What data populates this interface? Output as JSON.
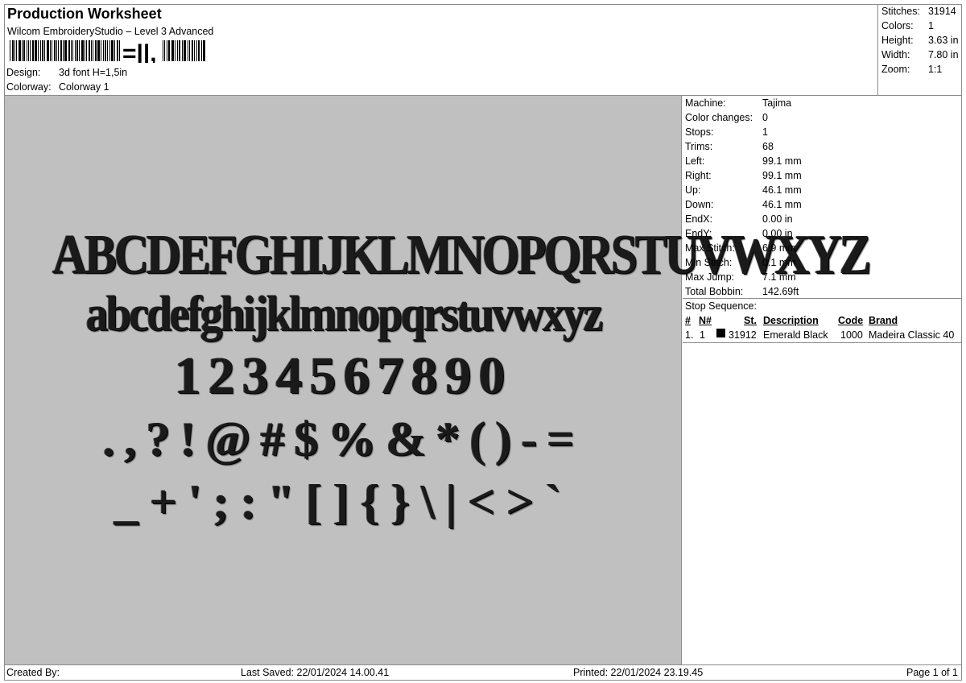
{
  "header": {
    "title": "Production Worksheet",
    "subtitle": "Wilcom EmbroideryStudio – Level 3 Advanced",
    "barcode_suffix": "=||,",
    "design_label": "Design:",
    "design_value": "3d font H=1,5in",
    "colorway_label": "Colorway:",
    "colorway_value": "Colorway 1"
  },
  "stats": [
    {
      "label": "Stitches:",
      "value": "31914"
    },
    {
      "label": "Colors:",
      "value": "1"
    },
    {
      "label": "Height:",
      "value": "3.63 in"
    },
    {
      "label": "Width:",
      "value": "7.80 in"
    },
    {
      "label": "Zoom:",
      "value": "1:1"
    }
  ],
  "design": {
    "rows": [
      "ABCDEFGHIJKLMNOPQRSTUVWXYZ",
      "abcdefghijklmnopqrstuvwxyz",
      "1234567890",
      ".,?!@#$%&*()-=",
      "_+';:\"[]{}\\|<>`"
    ],
    "thread_color": "#1a1a1a",
    "background_color": "#c0c0c0"
  },
  "machine": [
    {
      "label": "Machine:",
      "value": "Tajima"
    },
    {
      "label": "Color changes:",
      "value": "0"
    },
    {
      "label": "Stops:",
      "value": "1"
    },
    {
      "label": "Trims:",
      "value": "68"
    },
    {
      "label": "Left:",
      "value": "99.1 mm"
    },
    {
      "label": "Right:",
      "value": "99.1 mm"
    },
    {
      "label": "Up:",
      "value": "46.1 mm"
    },
    {
      "label": "Down:",
      "value": "46.1 mm"
    },
    {
      "label": "EndX:",
      "value": "0.00 in"
    },
    {
      "label": "EndY:",
      "value": "0.00 in"
    },
    {
      "label": "Max Stitch:",
      "value": "6.9 mm"
    },
    {
      "label": "Min Stitch:",
      "value": "0.1 mm"
    },
    {
      "label": "Max Jump:",
      "value": "7.1 mm"
    },
    {
      "label": "Total Bobbin:",
      "value": "142.69ft"
    }
  ],
  "stop_sequence": {
    "label": "Stop Sequence:",
    "headers": [
      "#",
      "N#",
      "St.",
      "Description",
      "Code",
      "Brand"
    ],
    "rows": [
      {
        "num": "1.",
        "n": "1",
        "color": "#000000",
        "stitches": "31912",
        "description": "Emerald Black",
        "code": "1000",
        "brand": "Madeira Classic 40"
      }
    ]
  },
  "footer": {
    "created_by": "Created By:",
    "last_saved": "Last Saved: 22/01/2024 14.00.41",
    "printed": "Printed: 22/01/2024 23.19.45",
    "page": "Page 1 of 1"
  }
}
